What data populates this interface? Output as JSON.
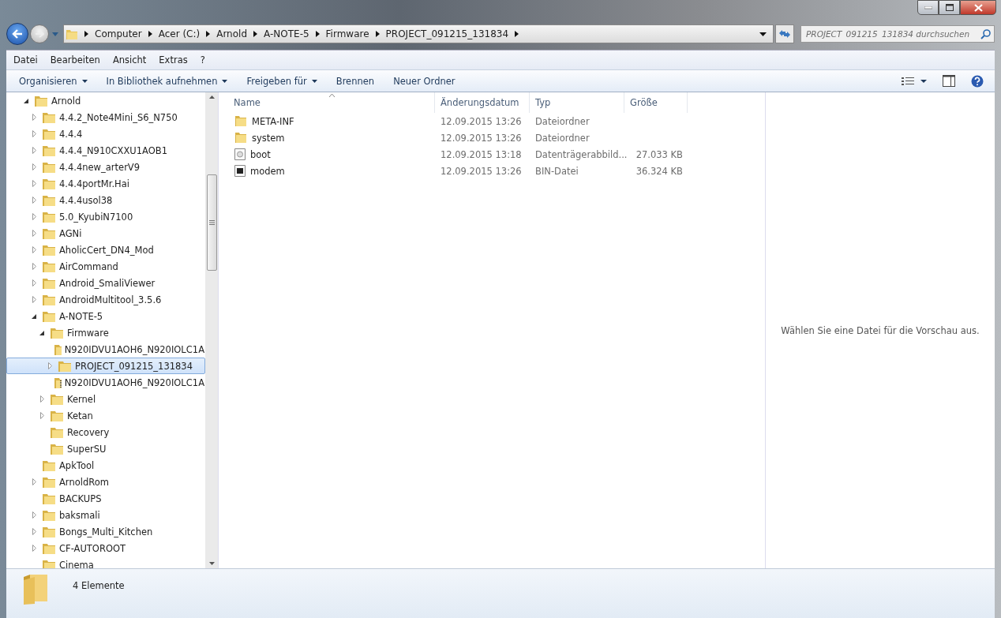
{
  "address_bar": {
    "breadcrumbs": [
      "Computer",
      "Acer (C:)",
      "Arnold",
      "A-NOTE-5",
      "Firmware",
      "PROJECT_091215_131834"
    ]
  },
  "search": {
    "placeholder": "PROJECT_091215_131834 durchsuchen"
  },
  "menu_bar": [
    "Datei",
    "Bearbeiten",
    "Ansicht",
    "Extras",
    "?"
  ],
  "toolbar": [
    {
      "label": "Organisieren",
      "dropdown": true
    },
    {
      "label": "In Bibliothek aufnehmen",
      "dropdown": true
    },
    {
      "label": "Freigeben für",
      "dropdown": true
    },
    {
      "label": "Brennen",
      "dropdown": false
    },
    {
      "label": "Neuer Ordner",
      "dropdown": false
    }
  ],
  "tree": [
    {
      "label": "Arnold",
      "has_children": true,
      "expanded": true,
      "kind": "folder",
      "selected": false,
      "children": [
        {
          "label": "4.4.2_Note4Mini_S6_N750",
          "has_children": true,
          "expanded": false,
          "kind": "folder",
          "selected": false
        },
        {
          "label": "4.4.4",
          "has_children": true,
          "expanded": false,
          "kind": "folder",
          "selected": false
        },
        {
          "label": "4.4.4_N910CXXU1AOB1",
          "has_children": true,
          "expanded": false,
          "kind": "folder",
          "selected": false
        },
        {
          "label": "4.4.4new_arterV9",
          "has_children": true,
          "expanded": false,
          "kind": "folder",
          "selected": false
        },
        {
          "label": "4.4.4portMr.Hai",
          "has_children": true,
          "expanded": false,
          "kind": "folder",
          "selected": false
        },
        {
          "label": "4.4.4usol38",
          "has_children": true,
          "expanded": false,
          "kind": "folder",
          "selected": false
        },
        {
          "label": "5.0_KyubiN7100",
          "has_children": true,
          "expanded": false,
          "kind": "folder",
          "selected": false
        },
        {
          "label": "AGNi",
          "has_children": true,
          "expanded": false,
          "kind": "folder",
          "selected": false
        },
        {
          "label": "AholicCert_DN4_Mod",
          "has_children": true,
          "expanded": false,
          "kind": "folder",
          "selected": false
        },
        {
          "label": "AirCommand",
          "has_children": true,
          "expanded": false,
          "kind": "folder",
          "selected": false
        },
        {
          "label": "Android_SmaliViewer",
          "has_children": true,
          "expanded": false,
          "kind": "folder",
          "selected": false
        },
        {
          "label": "AndroidMultitool_3.5.6",
          "has_children": true,
          "expanded": false,
          "kind": "folder",
          "selected": false
        },
        {
          "label": "A-NOTE-5",
          "has_children": true,
          "expanded": true,
          "kind": "folder",
          "selected": false,
          "children": [
            {
              "label": "Firmware",
              "has_children": true,
              "expanded": true,
              "kind": "folder",
              "selected": false,
              "children": [
                {
                  "label": "N920IDVU1AOH6_N920IOLC1A",
                  "has_children": false,
                  "kind": "folder",
                  "selected": false
                },
                {
                  "label": "PROJECT_091215_131834",
                  "has_children": true,
                  "expanded": false,
                  "kind": "folder",
                  "selected": true
                },
                {
                  "label": "N920IDVU1AOH6_N920IOLC1A",
                  "has_children": false,
                  "kind": "zip",
                  "selected": false
                }
              ]
            },
            {
              "label": "Kernel",
              "has_children": true,
              "expanded": false,
              "kind": "folder",
              "selected": false
            },
            {
              "label": "Ketan",
              "has_children": true,
              "expanded": false,
              "kind": "folder",
              "selected": false
            },
            {
              "label": "Recovery",
              "has_children": false,
              "kind": "folder",
              "selected": false
            },
            {
              "label": "SuperSU",
              "has_children": false,
              "kind": "folder",
              "selected": false
            }
          ]
        },
        {
          "label": "ApkTool",
          "has_children": false,
          "kind": "folder",
          "selected": false
        },
        {
          "label": "ArnoldRom",
          "has_children": true,
          "expanded": false,
          "kind": "folder",
          "selected": false
        },
        {
          "label": "BACKUPS",
          "has_children": false,
          "kind": "folder",
          "selected": false
        },
        {
          "label": "baksmali",
          "has_children": true,
          "expanded": false,
          "kind": "folder",
          "selected": false
        },
        {
          "label": "Bongs_Multi_Kitchen",
          "has_children": true,
          "expanded": false,
          "kind": "folder",
          "selected": false
        },
        {
          "label": "CF-AUTOROOT",
          "has_children": true,
          "expanded": false,
          "kind": "folder",
          "selected": false
        },
        {
          "label": "Cinema",
          "has_children": false,
          "kind": "folder",
          "selected": false
        }
      ]
    }
  ],
  "file_list": {
    "columns": [
      "Name",
      "Änderungsdatum",
      "Typ",
      "Größe"
    ],
    "rows": [
      {
        "name": "META-INF",
        "date": "12.09.2015 13:26",
        "type": "Dateiordner",
        "kind": "folder"
      },
      {
        "name": "system",
        "date": "12.09.2015 13:26",
        "type": "Dateiordner",
        "kind": "folder"
      },
      {
        "name": "boot",
        "date": "12.09.2015 13:18",
        "type": "Datenträgerabbild...",
        "size": "27.033 KB",
        "kind": "image"
      },
      {
        "name": "modem",
        "date": "12.09.2015 13:26",
        "type": "BIN-Datei",
        "size": "36.324 KB",
        "kind": "bin"
      }
    ]
  },
  "preview_pane": {
    "message": "Wählen Sie eine Datei für die Vorschau aus."
  },
  "status_bar": {
    "count": "4 Elemente"
  }
}
